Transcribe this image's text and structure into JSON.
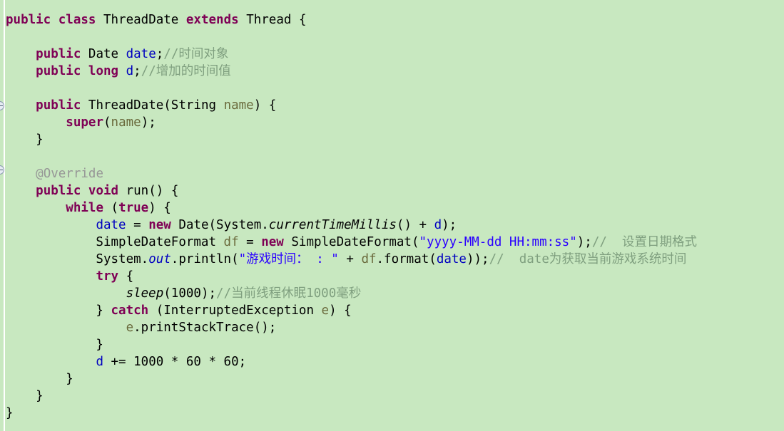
{
  "editor": {
    "language": "java",
    "background_color": "#c8e8c0",
    "gutter_line_color": "#ffffff",
    "colors": {
      "keyword": "#7f0055",
      "field": "#0000c0",
      "string": "#2a00ff",
      "comment": "#7f9f7f",
      "annotation": "#969696",
      "parameter": "#6a6a3c",
      "plain": "#000000"
    },
    "fold_markers": [
      {
        "name": "fold-marker-constructor",
        "line": 6
      },
      {
        "name": "fold-marker-run-method",
        "line": 10
      }
    ]
  },
  "code": {
    "class_name": "ThreadDate",
    "lines": [
      {
        "n": 1,
        "tokens": [
          {
            "t": "public",
            "k": "kw"
          },
          {
            "t": " ",
            "k": "plain"
          },
          {
            "t": "class",
            "k": "kw"
          },
          {
            "t": " ThreadDate ",
            "k": "plain"
          },
          {
            "t": "extends",
            "k": "kw"
          },
          {
            "t": " Thread {",
            "k": "plain"
          }
        ]
      },
      {
        "n": 2,
        "tokens": []
      },
      {
        "n": 3,
        "tokens": [
          {
            "t": "    ",
            "k": "plain"
          },
          {
            "t": "public",
            "k": "kw"
          },
          {
            "t": " Date ",
            "k": "plain"
          },
          {
            "t": "date",
            "k": "field"
          },
          {
            "t": ";",
            "k": "plain"
          },
          {
            "t": "//时间对象",
            "k": "cmt"
          }
        ]
      },
      {
        "n": 4,
        "tokens": [
          {
            "t": "    ",
            "k": "plain"
          },
          {
            "t": "public",
            "k": "kw"
          },
          {
            "t": " ",
            "k": "plain"
          },
          {
            "t": "long",
            "k": "kw"
          },
          {
            "t": " ",
            "k": "plain"
          },
          {
            "t": "d",
            "k": "field"
          },
          {
            "t": ";",
            "k": "plain"
          },
          {
            "t": "//增加的时间值",
            "k": "cmt"
          }
        ]
      },
      {
        "n": 5,
        "tokens": []
      },
      {
        "n": 6,
        "tokens": [
          {
            "t": "    ",
            "k": "plain"
          },
          {
            "t": "public",
            "k": "kw"
          },
          {
            "t": " ThreadDate(String ",
            "k": "plain"
          },
          {
            "t": "name",
            "k": "param"
          },
          {
            "t": ") {",
            "k": "plain"
          }
        ]
      },
      {
        "n": 7,
        "tokens": [
          {
            "t": "        ",
            "k": "plain"
          },
          {
            "t": "super",
            "k": "kw"
          },
          {
            "t": "(",
            "k": "plain"
          },
          {
            "t": "name",
            "k": "param"
          },
          {
            "t": ");",
            "k": "plain"
          }
        ]
      },
      {
        "n": 8,
        "tokens": [
          {
            "t": "    }",
            "k": "plain"
          }
        ]
      },
      {
        "n": 9,
        "tokens": []
      },
      {
        "n": 10,
        "tokens": [
          {
            "t": "    ",
            "k": "plain"
          },
          {
            "t": "@Override",
            "k": "anno"
          }
        ]
      },
      {
        "n": 11,
        "tokens": [
          {
            "t": "    ",
            "k": "plain"
          },
          {
            "t": "public",
            "k": "kw"
          },
          {
            "t": " ",
            "k": "plain"
          },
          {
            "t": "void",
            "k": "kw"
          },
          {
            "t": " run() {",
            "k": "plain"
          }
        ]
      },
      {
        "n": 12,
        "tokens": [
          {
            "t": "        ",
            "k": "plain"
          },
          {
            "t": "while",
            "k": "kw"
          },
          {
            "t": " (",
            "k": "plain"
          },
          {
            "t": "true",
            "k": "kw"
          },
          {
            "t": ") {",
            "k": "plain"
          }
        ]
      },
      {
        "n": 13,
        "tokens": [
          {
            "t": "            ",
            "k": "plain"
          },
          {
            "t": "date",
            "k": "field"
          },
          {
            "t": " = ",
            "k": "plain"
          },
          {
            "t": "new",
            "k": "kw"
          },
          {
            "t": " Date(System.",
            "k": "plain"
          },
          {
            "t": "currentTimeMillis",
            "k": "stat"
          },
          {
            "t": "() + ",
            "k": "plain"
          },
          {
            "t": "d",
            "k": "field"
          },
          {
            "t": ");",
            "k": "plain"
          }
        ]
      },
      {
        "n": 14,
        "tokens": [
          {
            "t": "            SimpleDateFormat ",
            "k": "plain"
          },
          {
            "t": "df",
            "k": "param"
          },
          {
            "t": " = ",
            "k": "plain"
          },
          {
            "t": "new",
            "k": "kw"
          },
          {
            "t": " SimpleDateFormat(",
            "k": "plain"
          },
          {
            "t": "\"yyyy-MM-dd HH:mm:ss\"",
            "k": "str"
          },
          {
            "t": ");",
            "k": "plain"
          },
          {
            "t": "//  设置日期格式",
            "k": "cmt"
          }
        ]
      },
      {
        "n": 15,
        "tokens": [
          {
            "t": "            System.",
            "k": "plain"
          },
          {
            "t": "out",
            "k": "statblue"
          },
          {
            "t": ".println(",
            "k": "plain"
          },
          {
            "t": "\"游戏时间： : \"",
            "k": "str"
          },
          {
            "t": " + ",
            "k": "plain"
          },
          {
            "t": "df",
            "k": "param"
          },
          {
            "t": ".format(",
            "k": "plain"
          },
          {
            "t": "date",
            "k": "field"
          },
          {
            "t": "));",
            "k": "plain"
          },
          {
            "t": "//  date为获取当前游戏系统时间",
            "k": "cmt"
          }
        ]
      },
      {
        "n": 16,
        "tokens": [
          {
            "t": "            ",
            "k": "plain"
          },
          {
            "t": "try",
            "k": "kw"
          },
          {
            "t": " {",
            "k": "plain"
          }
        ]
      },
      {
        "n": 17,
        "tokens": [
          {
            "t": "                ",
            "k": "plain"
          },
          {
            "t": "sleep",
            "k": "stat"
          },
          {
            "t": "(1000);",
            "k": "plain"
          },
          {
            "t": "//当前线程休眠1000毫秒",
            "k": "cmt"
          }
        ]
      },
      {
        "n": 18,
        "tokens": [
          {
            "t": "            } ",
            "k": "plain"
          },
          {
            "t": "catch",
            "k": "kw"
          },
          {
            "t": " (InterruptedException ",
            "k": "plain"
          },
          {
            "t": "e",
            "k": "param"
          },
          {
            "t": ") {",
            "k": "plain"
          }
        ]
      },
      {
        "n": 19,
        "tokens": [
          {
            "t": "                ",
            "k": "plain"
          },
          {
            "t": "e",
            "k": "param"
          },
          {
            "t": ".printStackTrace();",
            "k": "plain"
          }
        ]
      },
      {
        "n": 20,
        "tokens": [
          {
            "t": "            }",
            "k": "plain"
          }
        ]
      },
      {
        "n": 21,
        "tokens": [
          {
            "t": "            ",
            "k": "plain"
          },
          {
            "t": "d",
            "k": "field"
          },
          {
            "t": " += 1000 * 60 * 60;",
            "k": "plain"
          }
        ]
      },
      {
        "n": 22,
        "tokens": [
          {
            "t": "        }",
            "k": "plain"
          }
        ]
      },
      {
        "n": 23,
        "tokens": [
          {
            "t": "    }",
            "k": "plain"
          }
        ]
      },
      {
        "n": 24,
        "tokens": [
          {
            "t": "}",
            "k": "plain"
          }
        ]
      }
    ]
  }
}
